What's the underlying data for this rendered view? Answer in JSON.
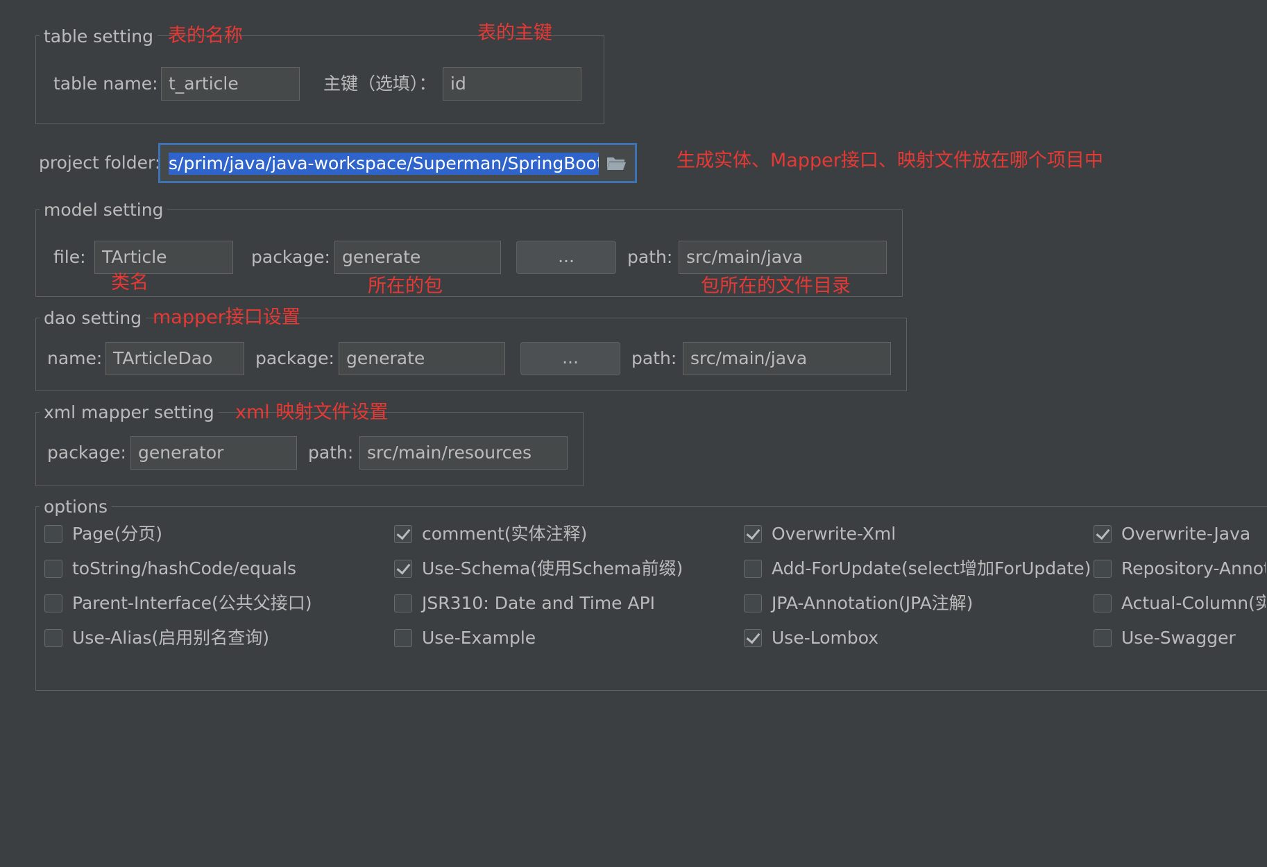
{
  "table_setting": {
    "title": "table setting",
    "table_name_label": "table  name:",
    "table_name_value": "t_article",
    "pk_label": "主键（选填）：",
    "pk_value": "id",
    "anno_name": "表的名称",
    "anno_pk": "表的主键"
  },
  "project": {
    "label": "project folder:",
    "value": "s/prim/java/java-workspace/Superman/SpringBoot/spri",
    "annotation": "生成实体、Mapper接口、映射文件放在哪个项目中"
  },
  "model_setting": {
    "title": "model setting",
    "file_label": "file:",
    "file_value": "TArticle",
    "package_label": "package:",
    "package_value": "generate",
    "browse_label": "...",
    "path_label": "path:",
    "path_value": "src/main/java",
    "anno_class": "类名",
    "anno_package": "所在的包",
    "anno_path": "包所在的文件目录"
  },
  "dao_setting": {
    "title": "dao setting",
    "annotation": "mapper接口设置",
    "name_label": "name:",
    "name_value": "TArticleDao",
    "package_label": "package:",
    "package_value": "generate",
    "browse_label": "...",
    "path_label": "path:",
    "path_value": "src/main/java"
  },
  "xml_setting": {
    "title": "xml mapper setting",
    "annotation": "xml 映射文件设置",
    "package_label": "package:",
    "package_value": "generator",
    "path_label": "path:",
    "path_value": "src/main/resources"
  },
  "options": {
    "title": "options",
    "items": [
      {
        "label": "Page(分页)",
        "checked": false
      },
      {
        "label": "comment(实体注释)",
        "checked": true
      },
      {
        "label": "Overwrite-Xml",
        "checked": true
      },
      {
        "label": "Overwrite-Java",
        "checked": true
      },
      {
        "label": "toString/hashCode/equals",
        "checked": false
      },
      {
        "label": "Use-Schema(使用Schema前缀)",
        "checked": true
      },
      {
        "label": "Add-ForUpdate(select增加ForUpdate)",
        "checked": false
      },
      {
        "label": "Repository-Annot",
        "checked": false
      },
      {
        "label": "Parent-Interface(公共父接口)",
        "checked": false
      },
      {
        "label": "JSR310: Date and Time API",
        "checked": false
      },
      {
        "label": "JPA-Annotation(JPA注解)",
        "checked": false
      },
      {
        "label": "Actual-Column(实",
        "checked": false
      },
      {
        "label": "Use-Alias(启用别名查询)",
        "checked": false
      },
      {
        "label": "Use-Example",
        "checked": false
      },
      {
        "label": "Use-Lombox",
        "checked": true
      },
      {
        "label": "Use-Swagger",
        "checked": false
      }
    ]
  },
  "colors": {
    "background": "#3c3f41",
    "text": "#bbbbbb",
    "annotation": "#e53935",
    "selection": "#2f65ca",
    "focus_border": "#3d72b5"
  }
}
